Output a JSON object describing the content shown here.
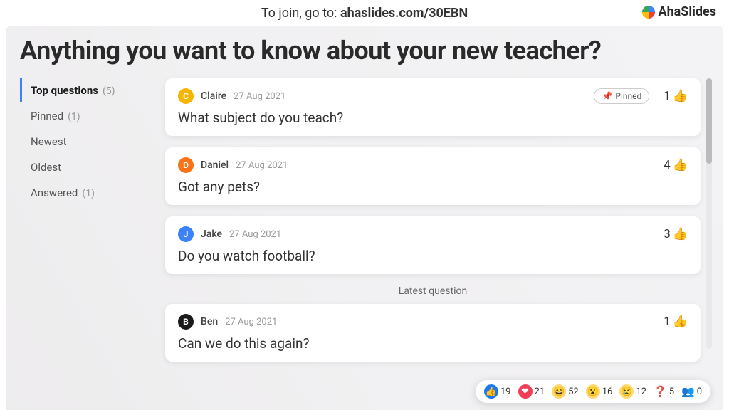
{
  "topbar": {
    "join_prefix": "To join, go to: ",
    "join_code": "ahaslides.com/30EBN",
    "logo_text": "AhaSlides"
  },
  "title": "Anything you want to know about your new teacher?",
  "filters": [
    {
      "label": "Top questions",
      "count": "(5)",
      "active": true
    },
    {
      "label": "Pinned",
      "count": "(1)",
      "active": false
    },
    {
      "label": "Newest",
      "count": "",
      "active": false
    },
    {
      "label": "Oldest",
      "count": "",
      "active": false
    },
    {
      "label": "Answered",
      "count": "(1)",
      "active": false
    }
  ],
  "latest_label": "Latest question",
  "pinned_label": "Pinned",
  "questions": [
    {
      "initial": "C",
      "color": "#f7b500",
      "author": "Claire",
      "date": "27 Aug 2021",
      "text": "What subject do you teach?",
      "likes": "1",
      "pinned": true
    },
    {
      "initial": "D",
      "color": "#f97316",
      "author": "Daniel",
      "date": "27 Aug 2021",
      "text": "Got any pets?",
      "likes": "4",
      "pinned": false
    },
    {
      "initial": "J",
      "color": "#3b82f6",
      "author": "Jake",
      "date": "27 Aug 2021",
      "text": "Do you watch football?",
      "likes": "3",
      "pinned": false
    }
  ],
  "latest": {
    "initial": "B",
    "color": "#1a1a1a",
    "author": "Ben",
    "date": "27 Aug 2021",
    "text": "Can we do this again?",
    "likes": "1"
  },
  "reactions": {
    "like": "19",
    "love": "21",
    "haha": "52",
    "wow": "16",
    "sad": "12",
    "question": "5",
    "people": "0"
  }
}
